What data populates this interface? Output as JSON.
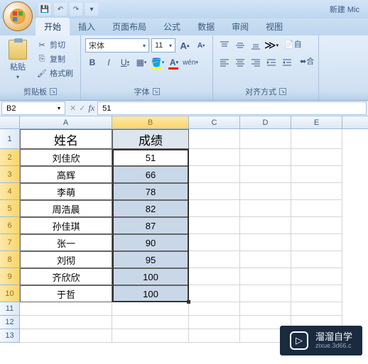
{
  "title": "新建 Mic",
  "tabs": [
    "开始",
    "插入",
    "页面布局",
    "公式",
    "数据",
    "审阅",
    "视图"
  ],
  "active_tab": 0,
  "clipboard": {
    "paste_label": "粘贴",
    "cut_label": "剪切",
    "copy_label": "复制",
    "format_painter_label": "格式刷",
    "group_label": "剪贴板"
  },
  "font": {
    "name": "宋体",
    "size": "11",
    "group_label": "字体"
  },
  "alignment": {
    "group_label": "对齐方式",
    "wrap_label": "自",
    "merge_label": "合"
  },
  "name_box": "B2",
  "formula_value": "51",
  "columns": [
    "A",
    "B",
    "C",
    "D",
    "E"
  ],
  "headers": {
    "A": "姓名",
    "B": "成绩"
  },
  "data_rows": [
    {
      "n": 2,
      "A": "刘佳欣",
      "B": "51"
    },
    {
      "n": 3,
      "A": "高辉",
      "B": "66"
    },
    {
      "n": 4,
      "A": "李萌",
      "B": "78"
    },
    {
      "n": 5,
      "A": "周浩晨",
      "B": "82"
    },
    {
      "n": 6,
      "A": "孙佳琪",
      "B": "87"
    },
    {
      "n": 7,
      "A": "张一",
      "B": "90"
    },
    {
      "n": 8,
      "A": "刘彻",
      "B": "95"
    },
    {
      "n": 9,
      "A": "齐欣欣",
      "B": "100"
    },
    {
      "n": 10,
      "A": "于哲",
      "B": "100"
    }
  ],
  "empty_rows": [
    11,
    12,
    13
  ],
  "watermark": {
    "main": "溜溜自学",
    "sub": "zixue.3d66.c"
  }
}
